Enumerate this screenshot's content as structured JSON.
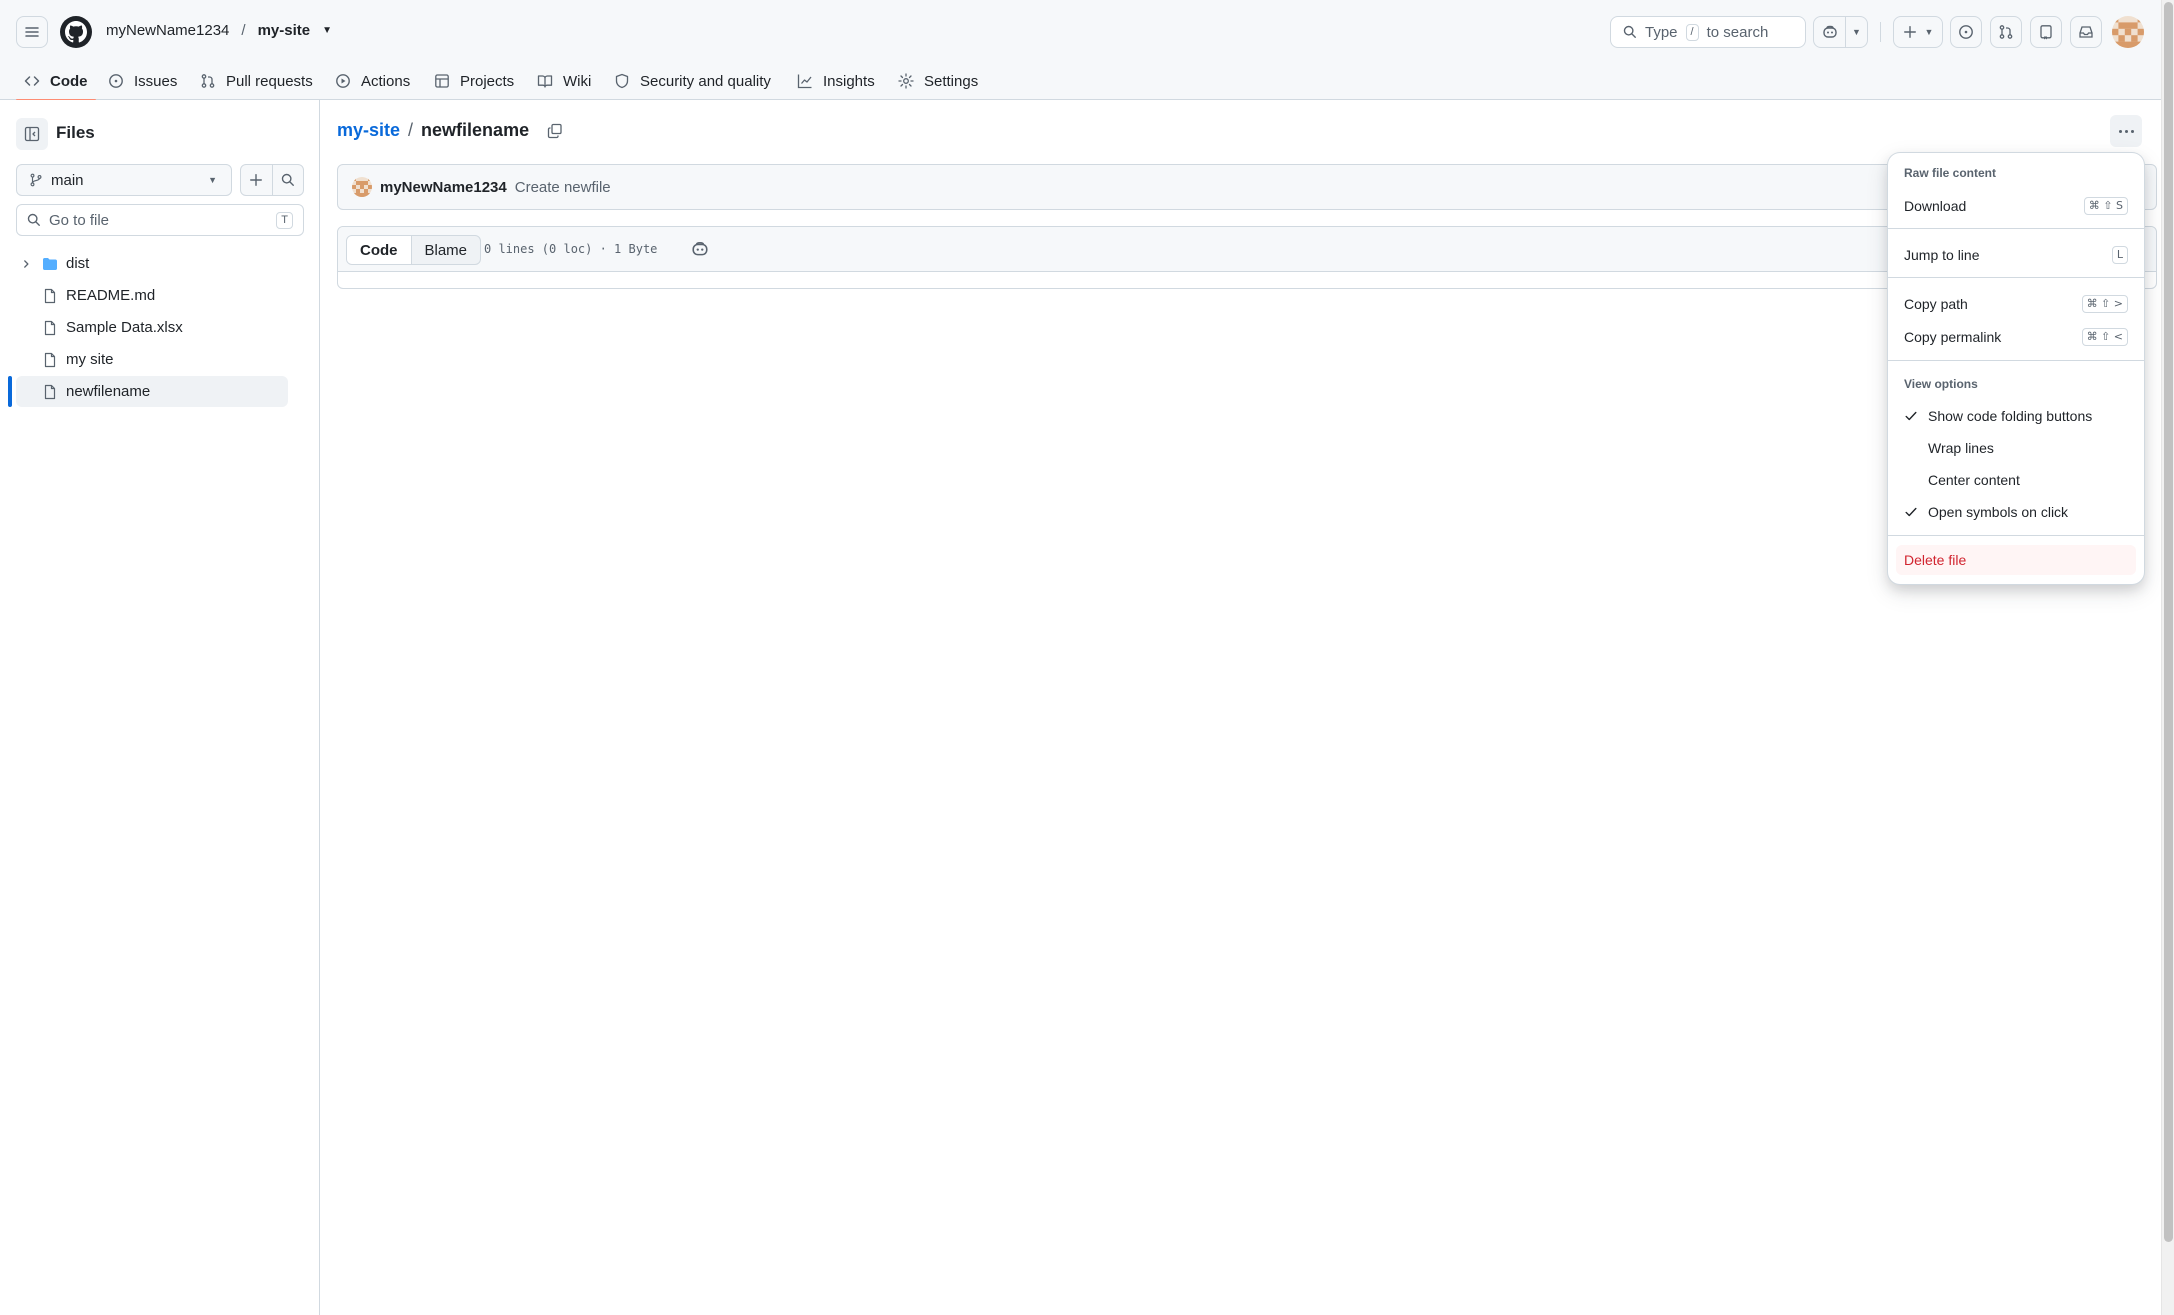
{
  "header": {
    "owner": "myNewName1234",
    "separator": "/",
    "repo": "my-site",
    "search": {
      "prefix": "Type",
      "key": "/",
      "suffix": "to search"
    }
  },
  "nav": {
    "items": [
      {
        "label": "Code",
        "icon": "code-icon",
        "active": true
      },
      {
        "label": "Issues",
        "icon": "issue-icon"
      },
      {
        "label": "Pull requests",
        "icon": "pull-request-icon"
      },
      {
        "label": "Actions",
        "icon": "play-icon"
      },
      {
        "label": "Projects",
        "icon": "table-icon"
      },
      {
        "label": "Wiki",
        "icon": "book-icon"
      },
      {
        "label": "Security and quality",
        "icon": "shield-icon"
      },
      {
        "label": "Insights",
        "icon": "graph-icon"
      },
      {
        "label": "Settings",
        "icon": "gear-icon"
      }
    ]
  },
  "sidebar": {
    "title": "Files",
    "branch": "main",
    "goto_placeholder": "Go to file",
    "goto_key": "T",
    "tree": [
      {
        "label": "dist",
        "type": "folder"
      },
      {
        "label": "README.md",
        "type": "file"
      },
      {
        "label": "Sample Data.xlsx",
        "type": "file"
      },
      {
        "label": "my site",
        "type": "file"
      },
      {
        "label": "newfilename",
        "type": "file",
        "active": true
      }
    ]
  },
  "main": {
    "breadcrumb_repo": "my-site",
    "breadcrumb_sep": "/",
    "breadcrumb_file": "newfilename",
    "commit": {
      "author": "myNewName1234",
      "message": "Create newfile"
    },
    "tabs": [
      "Code",
      "Blame"
    ],
    "file_info": "0 lines (0 loc) · 1 Byte"
  },
  "menu": {
    "group_raw": "Raw file content",
    "download": "Download",
    "download_shortcut": "⌘ ⇧ S",
    "jump": "Jump to line",
    "jump_shortcut": "L",
    "copy_path": "Copy path",
    "copy_path_shortcut": "⌘ ⇧ >",
    "copy_permalink": "Copy permalink",
    "copy_permalink_shortcut": "⌘ ⇧ <",
    "group_view": "View options",
    "show_folding": "Show code folding buttons",
    "show_folding_checked": true,
    "wrap_lines": "Wrap lines",
    "center_content": "Center content",
    "open_symbols": "Open symbols on click",
    "open_symbols_checked": true,
    "delete_file": "Delete file"
  },
  "colors": {
    "accent": "#0969da",
    "danger": "#d1242f",
    "nav_underline": "#fd8c73"
  }
}
